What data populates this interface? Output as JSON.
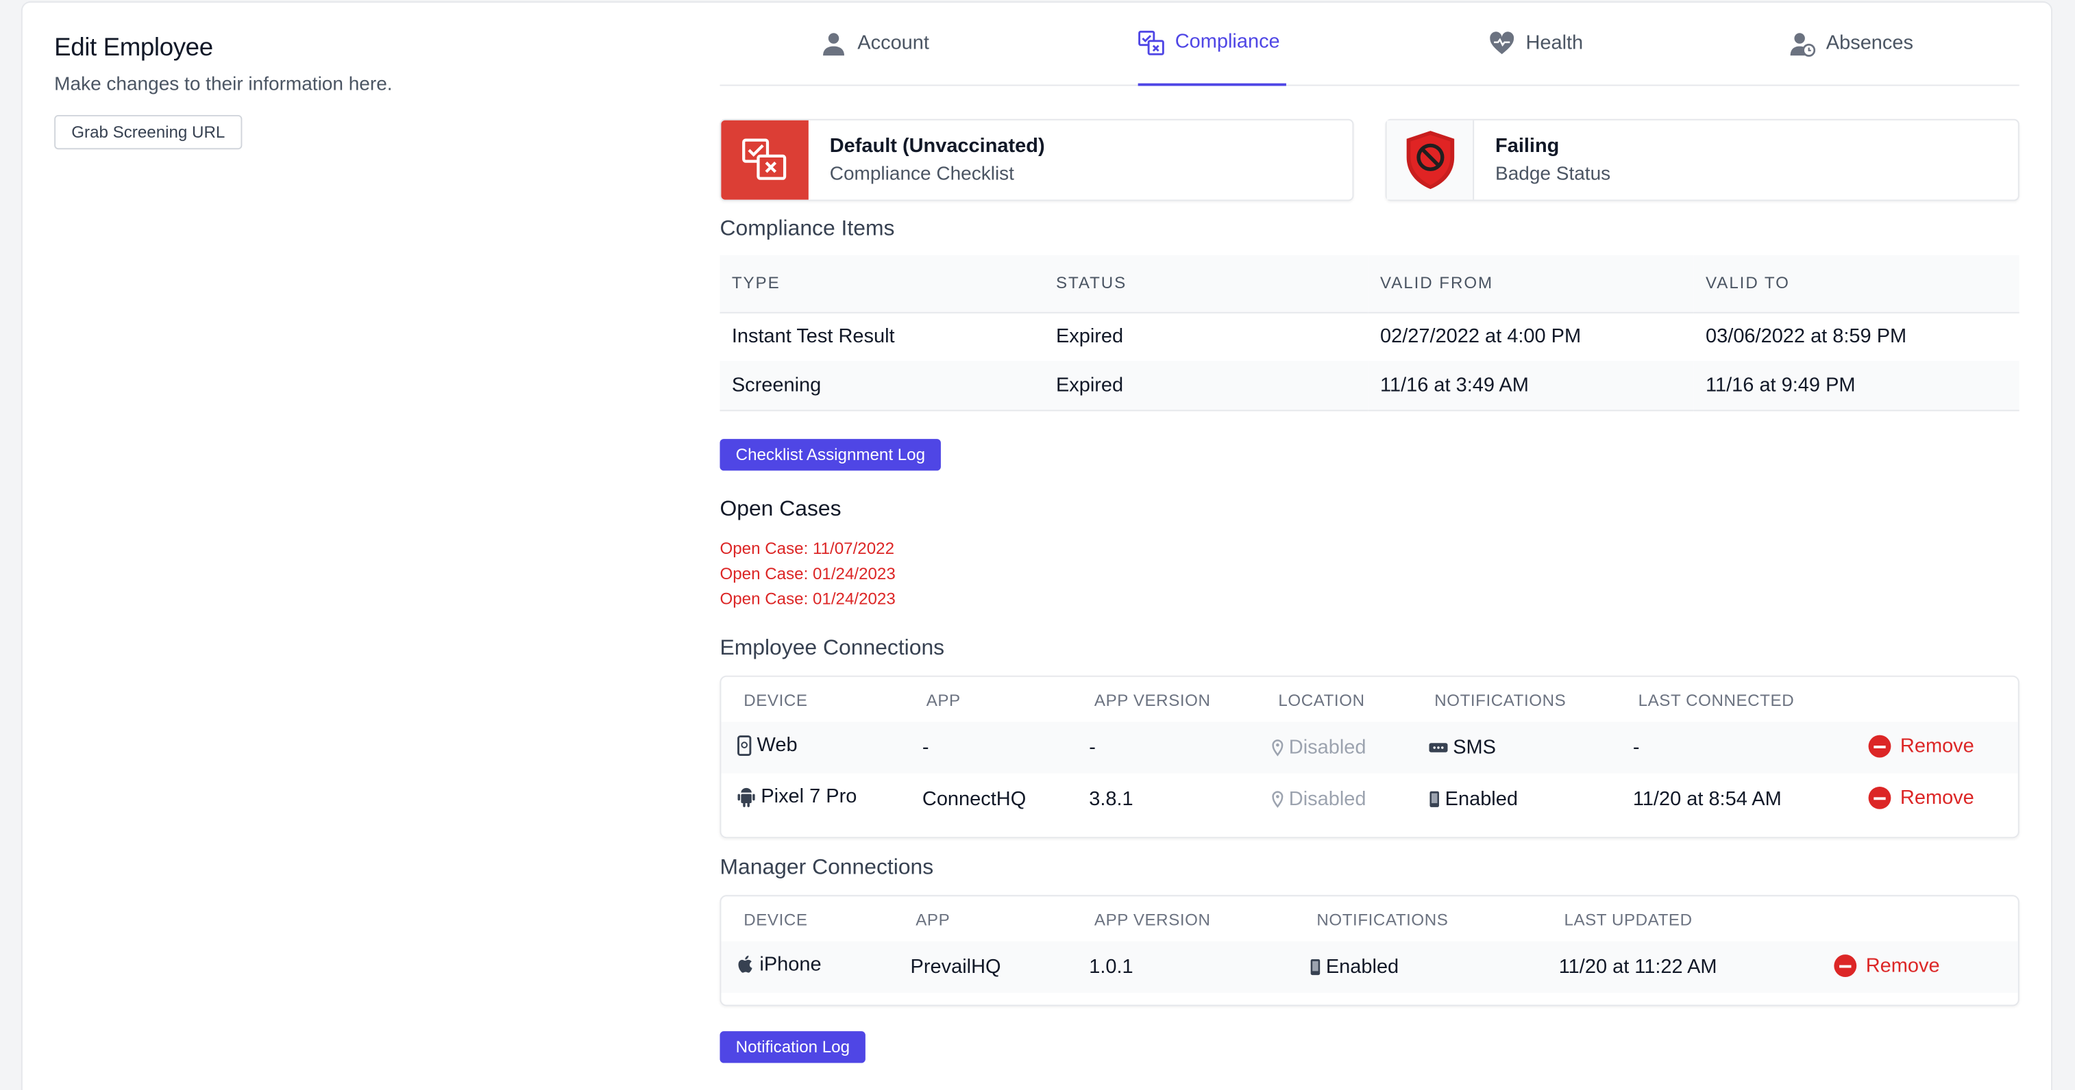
{
  "header": {
    "title": "Edit Employee",
    "subtitle": "Make changes to their information here.",
    "grab_url_button": "Grab Screening URL"
  },
  "tabs": [
    {
      "label": "Account",
      "icon": "user-icon",
      "active": false
    },
    {
      "label": "Compliance",
      "icon": "checklist-icon",
      "active": true
    },
    {
      "label": "Health",
      "icon": "heart-icon",
      "active": false
    },
    {
      "label": "Absences",
      "icon": "user-clock-icon",
      "active": false
    }
  ],
  "status_cards": {
    "checklist": {
      "title": "Default (Unvaccinated)",
      "subtitle": "Compliance Checklist",
      "icon": "checklist-icon",
      "color": "#dc3e35"
    },
    "badge": {
      "title": "Failing",
      "subtitle": "Badge Status",
      "icon": "shield-ban-icon",
      "color": "#dc2626"
    }
  },
  "compliance_items": {
    "title": "Compliance Items",
    "columns": [
      "TYPE",
      "STATUS",
      "VALID FROM",
      "VALID TO"
    ],
    "rows": [
      [
        "Instant Test Result",
        "Expired",
        "02/27/2022 at 4:00 PM",
        "03/06/2022 at 8:59 PM"
      ],
      [
        "Screening",
        "Expired",
        "11/16 at 3:49 AM",
        "11/16 at 9:49 PM"
      ]
    ]
  },
  "checklist_log_button": "Checklist Assignment Log",
  "open_cases": {
    "title": "Open Cases",
    "items": [
      "Open Case: 11/07/2022",
      "Open Case: 01/24/2023",
      "Open Case: 01/24/2023"
    ]
  },
  "employee_connections": {
    "title": "Employee Connections",
    "columns": [
      "DEVICE",
      "APP",
      "APP VERSION",
      "LOCATION",
      "NOTIFICATIONS",
      "LAST CONNECTED"
    ],
    "rows": [
      {
        "device": "Web",
        "device_icon": "web-device-icon",
        "app": "-",
        "version": "-",
        "location": "Disabled",
        "notifications": "SMS",
        "notif_icon": "sms-icon",
        "last": "-",
        "remove": "Remove"
      },
      {
        "device": "Pixel 7 Pro",
        "device_icon": "android-icon",
        "app": "ConnectHQ",
        "version": "3.8.1",
        "location": "Disabled",
        "notifications": "Enabled",
        "notif_icon": "phone-icon",
        "last": "11/20 at 8:54 AM",
        "remove": "Remove"
      }
    ]
  },
  "manager_connections": {
    "title": "Manager Connections",
    "columns": [
      "DEVICE",
      "APP",
      "APP VERSION",
      "NOTIFICATIONS",
      "LAST UPDATED"
    ],
    "rows": [
      {
        "device": "iPhone",
        "device_icon": "apple-icon",
        "app": "PrevailHQ",
        "version": "1.0.1",
        "notifications": "Enabled",
        "notif_icon": "phone-icon",
        "last": "11/20 at 11:22 AM",
        "remove": "Remove"
      }
    ]
  },
  "notification_log_button": "Notification Log",
  "colors": {
    "accent": "#4f46e5",
    "danger": "#dc2626",
    "muted": "#9ca3af"
  }
}
